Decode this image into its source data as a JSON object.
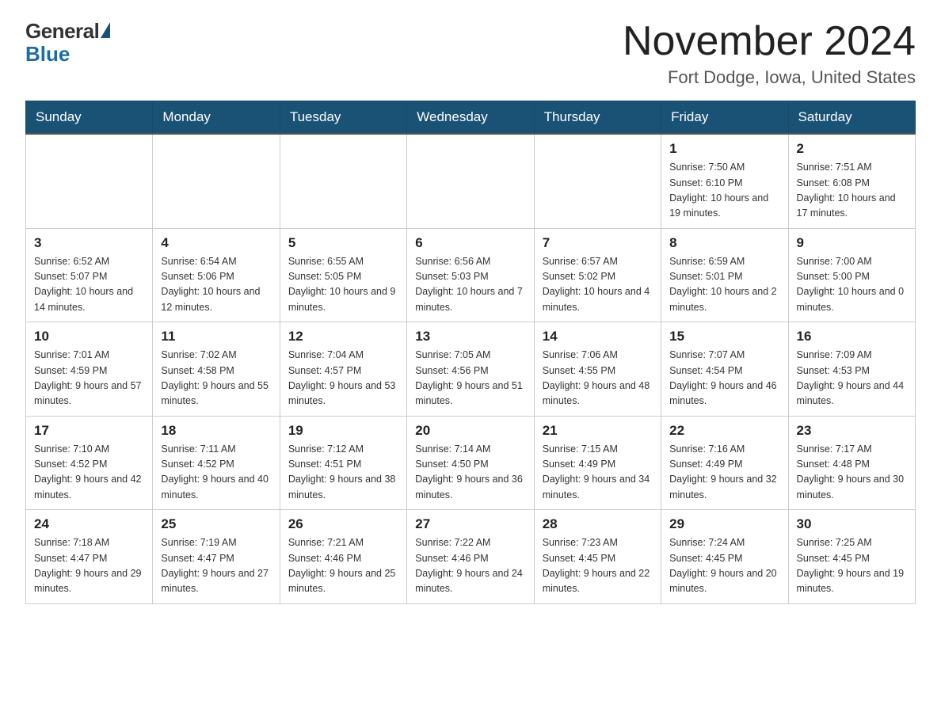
{
  "header": {
    "logo": {
      "general": "General",
      "blue": "Blue"
    },
    "title": "November 2024",
    "location": "Fort Dodge, Iowa, United States"
  },
  "weekdays": [
    "Sunday",
    "Monday",
    "Tuesday",
    "Wednesday",
    "Thursday",
    "Friday",
    "Saturday"
  ],
  "weeks": [
    [
      {
        "day": "",
        "sunrise": "",
        "sunset": "",
        "daylight": ""
      },
      {
        "day": "",
        "sunrise": "",
        "sunset": "",
        "daylight": ""
      },
      {
        "day": "",
        "sunrise": "",
        "sunset": "",
        "daylight": ""
      },
      {
        "day": "",
        "sunrise": "",
        "sunset": "",
        "daylight": ""
      },
      {
        "day": "",
        "sunrise": "",
        "sunset": "",
        "daylight": ""
      },
      {
        "day": "1",
        "sunrise": "Sunrise: 7:50 AM",
        "sunset": "Sunset: 6:10 PM",
        "daylight": "Daylight: 10 hours and 19 minutes."
      },
      {
        "day": "2",
        "sunrise": "Sunrise: 7:51 AM",
        "sunset": "Sunset: 6:08 PM",
        "daylight": "Daylight: 10 hours and 17 minutes."
      }
    ],
    [
      {
        "day": "3",
        "sunrise": "Sunrise: 6:52 AM",
        "sunset": "Sunset: 5:07 PM",
        "daylight": "Daylight: 10 hours and 14 minutes."
      },
      {
        "day": "4",
        "sunrise": "Sunrise: 6:54 AM",
        "sunset": "Sunset: 5:06 PM",
        "daylight": "Daylight: 10 hours and 12 minutes."
      },
      {
        "day": "5",
        "sunrise": "Sunrise: 6:55 AM",
        "sunset": "Sunset: 5:05 PM",
        "daylight": "Daylight: 10 hours and 9 minutes."
      },
      {
        "day": "6",
        "sunrise": "Sunrise: 6:56 AM",
        "sunset": "Sunset: 5:03 PM",
        "daylight": "Daylight: 10 hours and 7 minutes."
      },
      {
        "day": "7",
        "sunrise": "Sunrise: 6:57 AM",
        "sunset": "Sunset: 5:02 PM",
        "daylight": "Daylight: 10 hours and 4 minutes."
      },
      {
        "day": "8",
        "sunrise": "Sunrise: 6:59 AM",
        "sunset": "Sunset: 5:01 PM",
        "daylight": "Daylight: 10 hours and 2 minutes."
      },
      {
        "day": "9",
        "sunrise": "Sunrise: 7:00 AM",
        "sunset": "Sunset: 5:00 PM",
        "daylight": "Daylight: 10 hours and 0 minutes."
      }
    ],
    [
      {
        "day": "10",
        "sunrise": "Sunrise: 7:01 AM",
        "sunset": "Sunset: 4:59 PM",
        "daylight": "Daylight: 9 hours and 57 minutes."
      },
      {
        "day": "11",
        "sunrise": "Sunrise: 7:02 AM",
        "sunset": "Sunset: 4:58 PM",
        "daylight": "Daylight: 9 hours and 55 minutes."
      },
      {
        "day": "12",
        "sunrise": "Sunrise: 7:04 AM",
        "sunset": "Sunset: 4:57 PM",
        "daylight": "Daylight: 9 hours and 53 minutes."
      },
      {
        "day": "13",
        "sunrise": "Sunrise: 7:05 AM",
        "sunset": "Sunset: 4:56 PM",
        "daylight": "Daylight: 9 hours and 51 minutes."
      },
      {
        "day": "14",
        "sunrise": "Sunrise: 7:06 AM",
        "sunset": "Sunset: 4:55 PM",
        "daylight": "Daylight: 9 hours and 48 minutes."
      },
      {
        "day": "15",
        "sunrise": "Sunrise: 7:07 AM",
        "sunset": "Sunset: 4:54 PM",
        "daylight": "Daylight: 9 hours and 46 minutes."
      },
      {
        "day": "16",
        "sunrise": "Sunrise: 7:09 AM",
        "sunset": "Sunset: 4:53 PM",
        "daylight": "Daylight: 9 hours and 44 minutes."
      }
    ],
    [
      {
        "day": "17",
        "sunrise": "Sunrise: 7:10 AM",
        "sunset": "Sunset: 4:52 PM",
        "daylight": "Daylight: 9 hours and 42 minutes."
      },
      {
        "day": "18",
        "sunrise": "Sunrise: 7:11 AM",
        "sunset": "Sunset: 4:52 PM",
        "daylight": "Daylight: 9 hours and 40 minutes."
      },
      {
        "day": "19",
        "sunrise": "Sunrise: 7:12 AM",
        "sunset": "Sunset: 4:51 PM",
        "daylight": "Daylight: 9 hours and 38 minutes."
      },
      {
        "day": "20",
        "sunrise": "Sunrise: 7:14 AM",
        "sunset": "Sunset: 4:50 PM",
        "daylight": "Daylight: 9 hours and 36 minutes."
      },
      {
        "day": "21",
        "sunrise": "Sunrise: 7:15 AM",
        "sunset": "Sunset: 4:49 PM",
        "daylight": "Daylight: 9 hours and 34 minutes."
      },
      {
        "day": "22",
        "sunrise": "Sunrise: 7:16 AM",
        "sunset": "Sunset: 4:49 PM",
        "daylight": "Daylight: 9 hours and 32 minutes."
      },
      {
        "day": "23",
        "sunrise": "Sunrise: 7:17 AM",
        "sunset": "Sunset: 4:48 PM",
        "daylight": "Daylight: 9 hours and 30 minutes."
      }
    ],
    [
      {
        "day": "24",
        "sunrise": "Sunrise: 7:18 AM",
        "sunset": "Sunset: 4:47 PM",
        "daylight": "Daylight: 9 hours and 29 minutes."
      },
      {
        "day": "25",
        "sunrise": "Sunrise: 7:19 AM",
        "sunset": "Sunset: 4:47 PM",
        "daylight": "Daylight: 9 hours and 27 minutes."
      },
      {
        "day": "26",
        "sunrise": "Sunrise: 7:21 AM",
        "sunset": "Sunset: 4:46 PM",
        "daylight": "Daylight: 9 hours and 25 minutes."
      },
      {
        "day": "27",
        "sunrise": "Sunrise: 7:22 AM",
        "sunset": "Sunset: 4:46 PM",
        "daylight": "Daylight: 9 hours and 24 minutes."
      },
      {
        "day": "28",
        "sunrise": "Sunrise: 7:23 AM",
        "sunset": "Sunset: 4:45 PM",
        "daylight": "Daylight: 9 hours and 22 minutes."
      },
      {
        "day": "29",
        "sunrise": "Sunrise: 7:24 AM",
        "sunset": "Sunset: 4:45 PM",
        "daylight": "Daylight: 9 hours and 20 minutes."
      },
      {
        "day": "30",
        "sunrise": "Sunrise: 7:25 AM",
        "sunset": "Sunset: 4:45 PM",
        "daylight": "Daylight: 9 hours and 19 minutes."
      }
    ]
  ]
}
